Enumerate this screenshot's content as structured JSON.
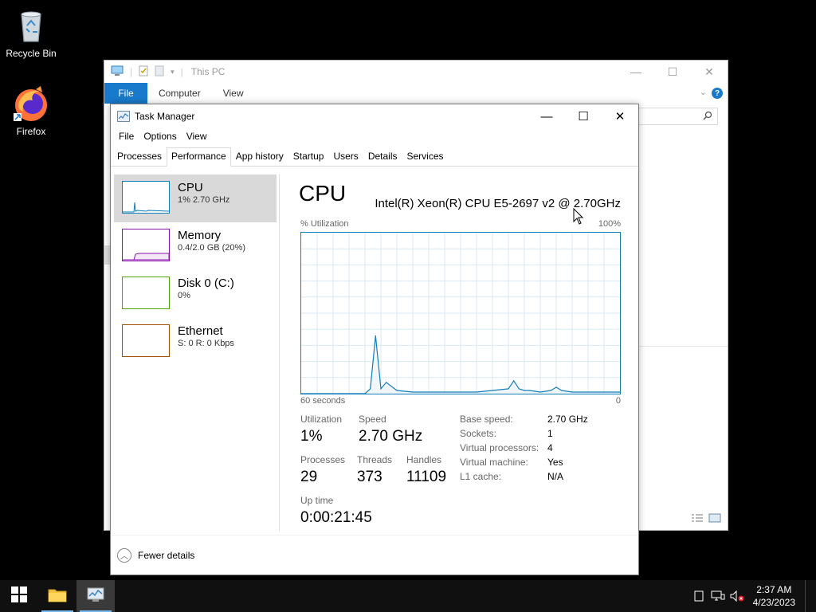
{
  "desktop": {
    "icons": [
      {
        "label": "Recycle Bin",
        "icon": "recycle-bin-icon"
      },
      {
        "label": "Firefox",
        "icon": "firefox-icon"
      }
    ]
  },
  "explorer": {
    "title": "This PC",
    "ribbon_tabs": [
      "File",
      "Computer",
      "View"
    ],
    "accent": "#1979ca"
  },
  "taskmanager": {
    "title": "Task Manager",
    "menu": [
      "File",
      "Options",
      "View"
    ],
    "tabs": [
      "Processes",
      "Performance",
      "App history",
      "Startup",
      "Users",
      "Details",
      "Services"
    ],
    "active_tab": "Performance",
    "sidebar": [
      {
        "name": "CPU",
        "sub": "1% 2.70 GHz",
        "color": "#117dbb"
      },
      {
        "name": "Memory",
        "sub": "0.4/2.0 GB (20%)",
        "color": "#8b12ae"
      },
      {
        "name": "Disk 0 (C:)",
        "sub": "0%",
        "color": "#4da60c"
      },
      {
        "name": "Ethernet",
        "sub": "S: 0 R: 0 Kbps",
        "color": "#a74f01"
      }
    ],
    "detail": {
      "heading": "CPU",
      "model": "Intel(R) Xeon(R) CPU E5-2697 v2 @ 2.70GHz",
      "graph_label": "% Utilization",
      "graph_max": "100%",
      "graph_window": "60 seconds",
      "graph_min": "0",
      "utilization_label": "Utilization",
      "utilization": "1%",
      "speed_label": "Speed",
      "speed": "2.70 GHz",
      "processes_label": "Processes",
      "processes": "29",
      "threads_label": "Threads",
      "threads": "373",
      "handles_label": "Handles",
      "handles": "11109",
      "uptime_label": "Up time",
      "uptime": "0:00:21:45",
      "specs": [
        {
          "k": "Base speed:",
          "v": "2.70 GHz"
        },
        {
          "k": "Sockets:",
          "v": "1"
        },
        {
          "k": "Virtual processors:",
          "v": "4"
        },
        {
          "k": "Virtual machine:",
          "v": "Yes"
        },
        {
          "k": "L1 cache:",
          "v": "N/A"
        }
      ]
    },
    "footer": "Fewer details"
  },
  "chart_data": {
    "type": "line",
    "ylabel": "% Utilization",
    "ylim": [
      0,
      100
    ],
    "xlabel": "60 seconds",
    "x": [
      60,
      57,
      54,
      51,
      49,
      48,
      47,
      46,
      45,
      44,
      42,
      39,
      36,
      33,
      30,
      27,
      24,
      21,
      20,
      19,
      18,
      17,
      15,
      13,
      12,
      11,
      9,
      6,
      3,
      0
    ],
    "series": [
      {
        "values": [
          0,
          0,
          0,
          0,
          0,
          0,
          3,
          36,
          3,
          7,
          2,
          1,
          1,
          1,
          1,
          1,
          2,
          3,
          8,
          3,
          2,
          2,
          1,
          2,
          4,
          2,
          1,
          1,
          1,
          1
        ]
      }
    ]
  },
  "taskbar": {
    "time": "2:37 AM",
    "date": "4/23/2023"
  }
}
